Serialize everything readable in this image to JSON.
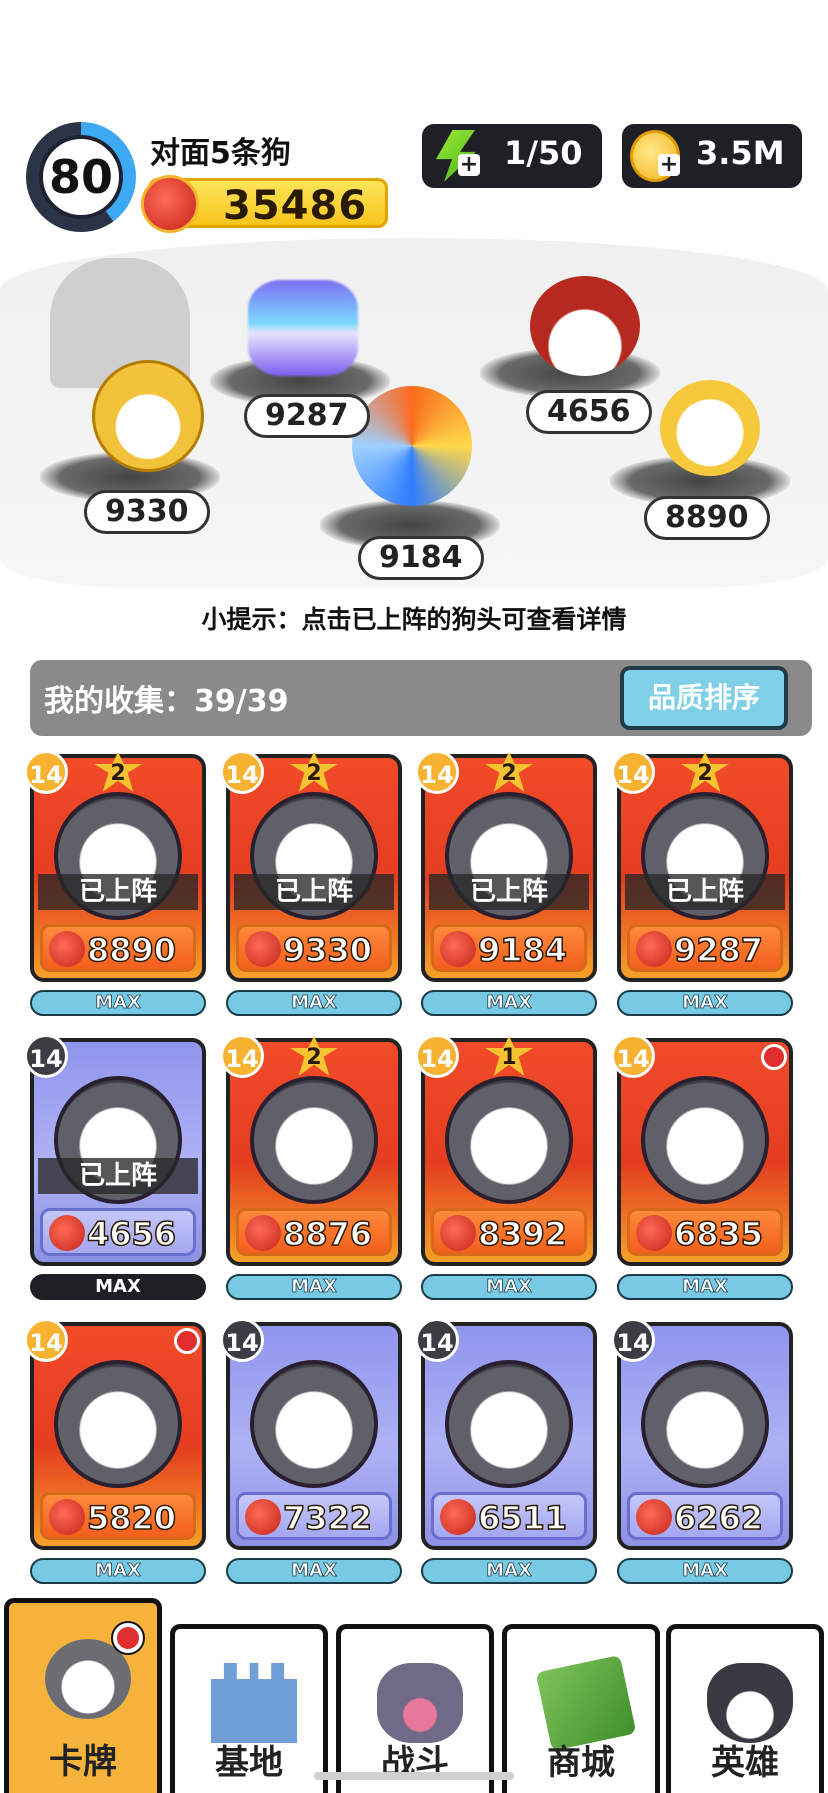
{
  "hud": {
    "level": "80",
    "player_name": "对面5条狗",
    "power": "35486",
    "energy": "1/50",
    "coins": "3.5M",
    "icons": [
      "level-ring",
      "fist-icon",
      "lightning-icon",
      "gold-coin-icon",
      "plus-icon"
    ]
  },
  "arena": {
    "pets": [
      {
        "name": "gold-helmet-dog",
        "power": "9330"
      },
      {
        "name": "glitch-dog",
        "power": "9287"
      },
      {
        "name": "fire-ice-dog",
        "power": "9184"
      },
      {
        "name": "soldier-dog",
        "power": "4656"
      },
      {
        "name": "crown-dog",
        "power": "8890"
      }
    ],
    "tip": "小提示：点击已上阵的狗头可查看详情"
  },
  "collection": {
    "title": "我的收集：39/39",
    "sort_button": "品质排序"
  },
  "cards": [
    {
      "level": "14",
      "stars": "2",
      "deployed": "已上阵",
      "power": "8890",
      "max": "MAX",
      "rarity": "red"
    },
    {
      "level": "14",
      "stars": "2",
      "deployed": "已上阵",
      "power": "9330",
      "max": "MAX",
      "rarity": "red"
    },
    {
      "level": "14",
      "stars": "2",
      "deployed": "已上阵",
      "power": "9184",
      "max": "MAX",
      "rarity": "red"
    },
    {
      "level": "14",
      "stars": "2",
      "deployed": "已上阵",
      "power": "9287",
      "max": "MAX",
      "rarity": "red"
    },
    {
      "level": "14",
      "stars": "",
      "deployed": "已上阵",
      "power": "4656",
      "max": "MAX",
      "rarity": "blue"
    },
    {
      "level": "14",
      "stars": "2",
      "deployed": "",
      "power": "8876",
      "max": "MAX",
      "rarity": "red"
    },
    {
      "level": "14",
      "stars": "1",
      "deployed": "",
      "power": "8392",
      "max": "MAX",
      "rarity": "red"
    },
    {
      "level": "14",
      "stars": "",
      "deployed": "",
      "power": "6835",
      "max": "MAX",
      "rarity": "red"
    },
    {
      "level": "14",
      "stars": "",
      "deployed": "",
      "power": "5820",
      "max": "MAX",
      "rarity": "red"
    },
    {
      "level": "14",
      "stars": "",
      "deployed": "",
      "power": "7322",
      "max": "MAX",
      "rarity": "blue"
    },
    {
      "level": "14",
      "stars": "",
      "deployed": "",
      "power": "6511",
      "max": "MAX",
      "rarity": "blue"
    },
    {
      "level": "14",
      "stars": "",
      "deployed": "",
      "power": "6262",
      "max": "MAX",
      "rarity": "blue"
    }
  ],
  "nav": [
    {
      "label": "卡牌",
      "icon": "dog-card-icon",
      "active": true
    },
    {
      "label": "基地",
      "icon": "castle-icon",
      "active": false
    },
    {
      "label": "战斗",
      "icon": "paw-icon",
      "active": false
    },
    {
      "label": "商城",
      "icon": "money-icon",
      "active": false
    },
    {
      "label": "英雄",
      "icon": "hero-dog-icon",
      "active": false
    }
  ],
  "colors": {
    "accent_red": "#e43d1f",
    "accent_blue": "#8f95ec",
    "nav_active": "#f6b33b",
    "max_bar": "#78c9e3",
    "level_ring": "#3da9f2"
  }
}
